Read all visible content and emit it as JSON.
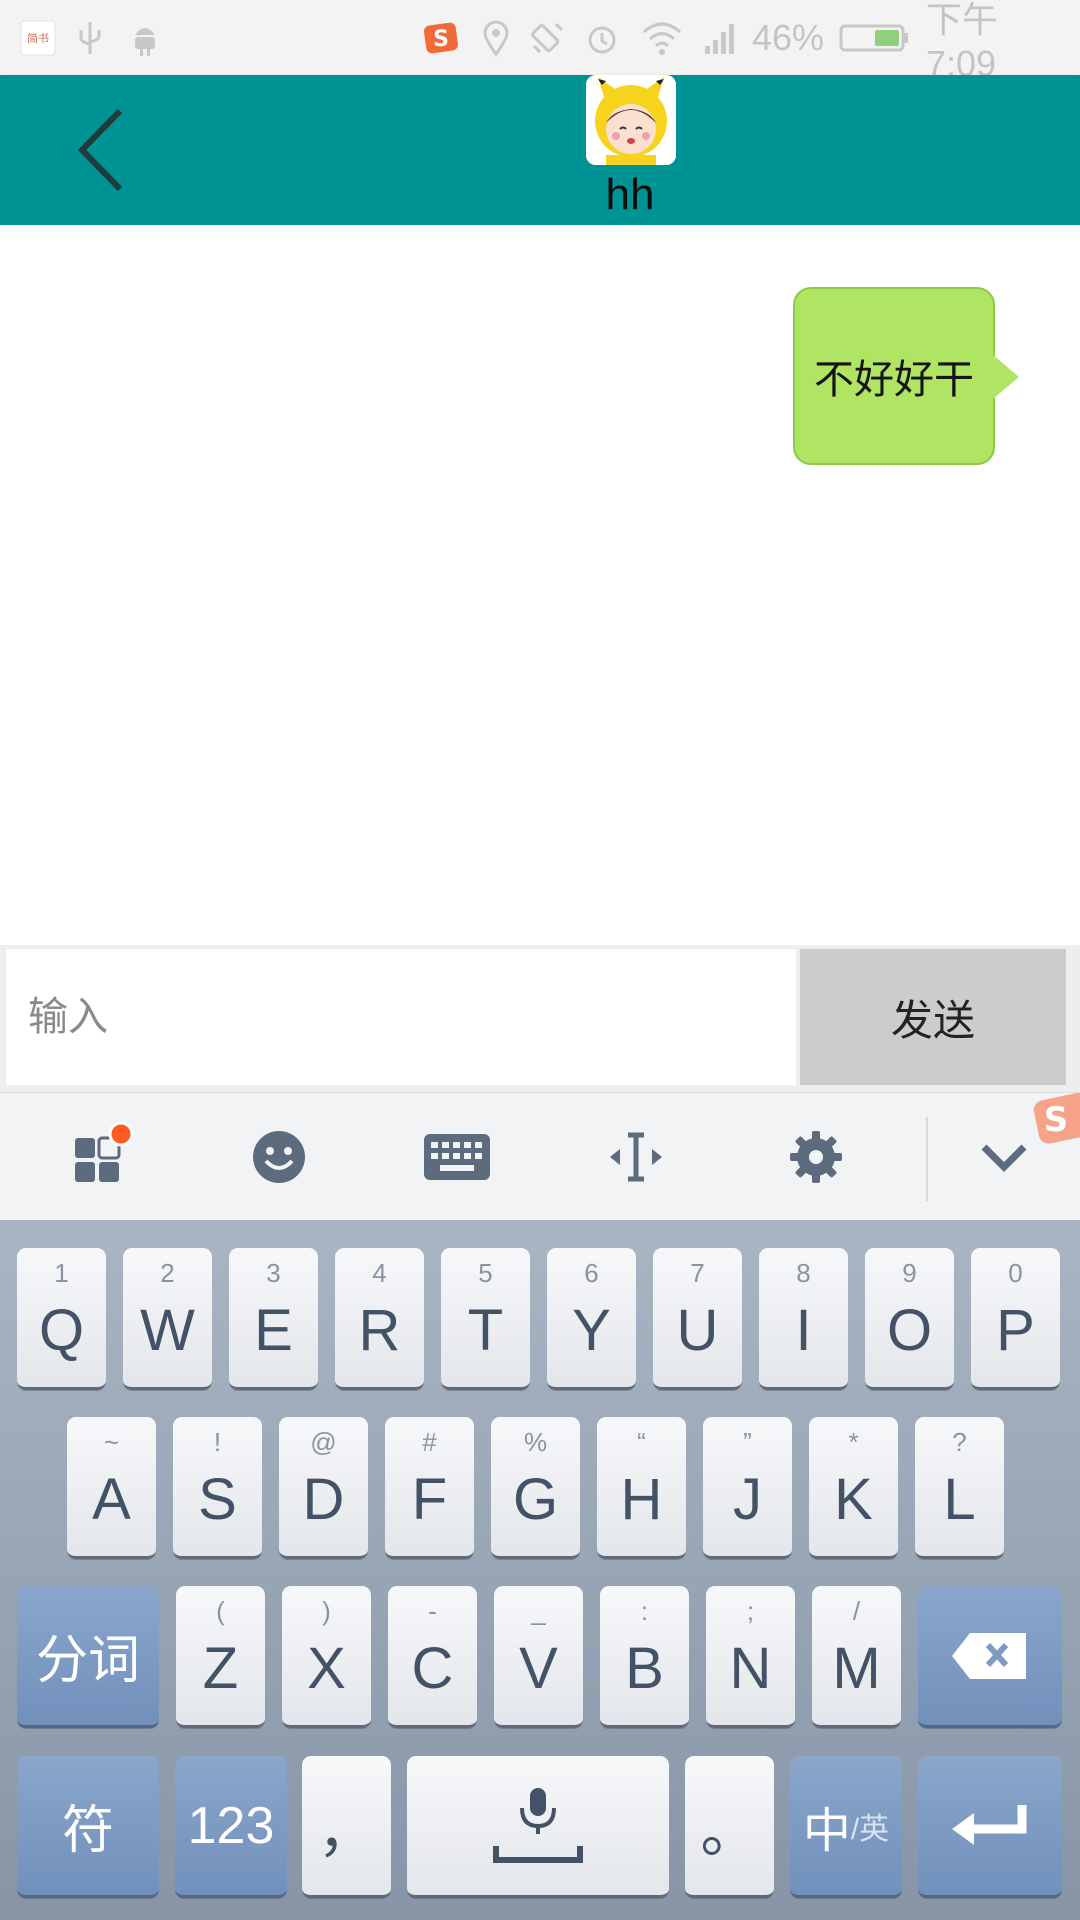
{
  "status_bar": {
    "left_icons": [
      "jianshu-app-icon",
      "usb-icon",
      "android-debug-icon"
    ],
    "right_icons": [
      "sogou-ime-icon",
      "location-icon",
      "rotation-icon",
      "alarm-icon",
      "wifi-icon",
      "signal-icon"
    ],
    "battery": "46%",
    "time": "下午7:09"
  },
  "header": {
    "contact_name": "hh",
    "back_icon": "chevron-left-icon",
    "avatar": "cartoon-avatar"
  },
  "chat": {
    "messages": [
      {
        "side": "right",
        "text": "不好好干"
      }
    ]
  },
  "composer": {
    "placeholder": "输入",
    "send_label": "发送"
  },
  "ime_toolbar": {
    "icons": [
      "apps-grid-icon",
      "emoji-icon",
      "keyboard-icon",
      "cursor-move-icon",
      "settings-gear-icon",
      "collapse-chevron-icon"
    ],
    "has_notification_dot": true
  },
  "keyboard": {
    "row1": [
      {
        "hint": "1",
        "key": "Q"
      },
      {
        "hint": "2",
        "key": "W"
      },
      {
        "hint": "3",
        "key": "E"
      },
      {
        "hint": "4",
        "key": "R"
      },
      {
        "hint": "5",
        "key": "T"
      },
      {
        "hint": "6",
        "key": "Y"
      },
      {
        "hint": "7",
        "key": "U"
      },
      {
        "hint": "8",
        "key": "I"
      },
      {
        "hint": "9",
        "key": "O"
      },
      {
        "hint": "0",
        "key": "P"
      }
    ],
    "row2": [
      {
        "hint": "~",
        "key": "A"
      },
      {
        "hint": "!",
        "key": "S"
      },
      {
        "hint": "@",
        "key": "D"
      },
      {
        "hint": "#",
        "key": "F"
      },
      {
        "hint": "%",
        "key": "G"
      },
      {
        "hint": "“",
        "key": "H"
      },
      {
        "hint": "”",
        "key": "J"
      },
      {
        "hint": "*",
        "key": "K"
      },
      {
        "hint": "?",
        "key": "L"
      }
    ],
    "row3_left": "分词",
    "row3": [
      {
        "hint": "(",
        "key": "Z"
      },
      {
        "hint": ")",
        "key": "X"
      },
      {
        "hint": "-",
        "key": "C"
      },
      {
        "hint": "_",
        "key": "V"
      },
      {
        "hint": ":",
        "key": "B"
      },
      {
        "hint": ";",
        "key": "N"
      },
      {
        "hint": "/",
        "key": "M"
      }
    ],
    "backspace_icon": "backspace-icon",
    "row4": {
      "symbols": "符",
      "numbers": "123",
      "comma": "，",
      "space_icon": "microphone-icon",
      "period": "。",
      "lang_main": "中",
      "lang_sub": "/英",
      "enter_icon": "enter-icon"
    }
  },
  "colors": {
    "header": "#009393",
    "bubble": "#b0e564",
    "send_button": "#cccccc",
    "func_key": "#7f9ac3"
  }
}
